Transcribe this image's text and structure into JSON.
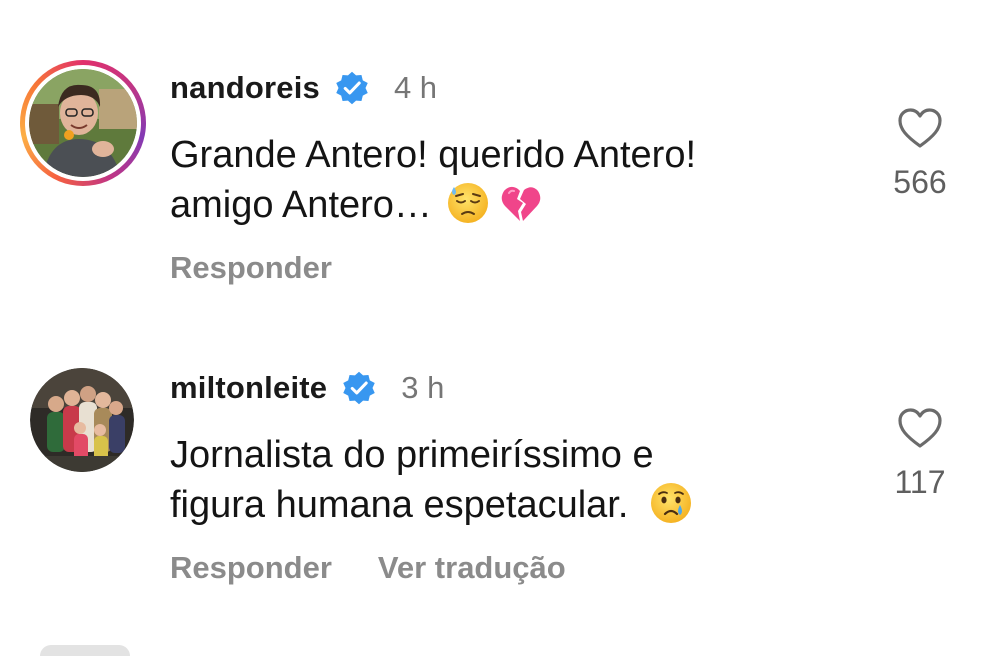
{
  "top_fragment_text": "",
  "comments": [
    {
      "username": "nandoreis",
      "verified": true,
      "time": "4 h",
      "text_line1": "Grande Antero! querido Antero!",
      "text_line2": "amigo Antero…",
      "emojis": [
        "downcast-face-with-sweat-emoji",
        "broken-heart-emoji"
      ],
      "likes": "566",
      "actions": [
        "Responder"
      ],
      "has_story_ring": true
    },
    {
      "username": "miltonleite",
      "verified": true,
      "time": "3 h",
      "text_line1": "Jornalista do primeiríssimo e",
      "text_line2": "figura humana espetacular.",
      "emojis": [
        "crying-face-emoji"
      ],
      "likes": "117",
      "actions": [
        "Responder",
        "Ver tradução"
      ],
      "has_story_ring": false
    }
  ],
  "colors": {
    "verified_blue": "#3897f0",
    "text_primary": "#141414",
    "text_secondary": "#767676",
    "action_gray": "#8b8b8b"
  }
}
